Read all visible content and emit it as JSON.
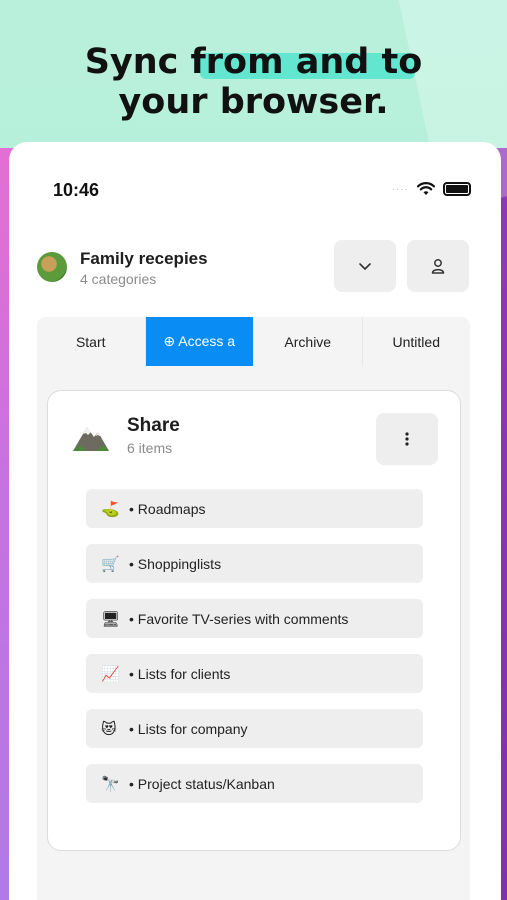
{
  "promo": {
    "headline_line1": "Sync from and to",
    "headline_line2": "your browser.",
    "highlight_color": "#62e6cf"
  },
  "status_bar": {
    "time": "10:46",
    "signal_dots": "····",
    "wifi_icon": "wifi-icon",
    "battery_icon": "battery-icon"
  },
  "list": {
    "title": "Family recepies",
    "subtitle": "4 categories",
    "avatar_icon": "salad-emoji-icon",
    "chevron_icon": "chevron-down-icon",
    "person_icon": "person-icon"
  },
  "tabs": [
    {
      "label": "Start",
      "active": false
    },
    {
      "label": "⊕ Access a",
      "active": true
    },
    {
      "label": "Archive",
      "active": false
    },
    {
      "label": "Untitled",
      "active": false
    }
  ],
  "accent_color": "#0a8cf5",
  "card": {
    "title": "Share",
    "subtitle": "6 items",
    "icon": "mountain-icon",
    "more_icon": "vertical-dots-icon",
    "items": [
      {
        "emoji": "⛳",
        "label": "• Roadmaps"
      },
      {
        "emoji": "🛒",
        "label": "• Shoppinglists"
      },
      {
        "emoji": "🖥",
        "label": "• Favorite TV-series with comments"
      },
      {
        "emoji": "📈",
        "label": "• Lists for clients"
      },
      {
        "emoji": "😻",
        "label": "• Lists for company"
      },
      {
        "emoji": "🔭",
        "label": "• Project status/Kanban"
      }
    ]
  }
}
